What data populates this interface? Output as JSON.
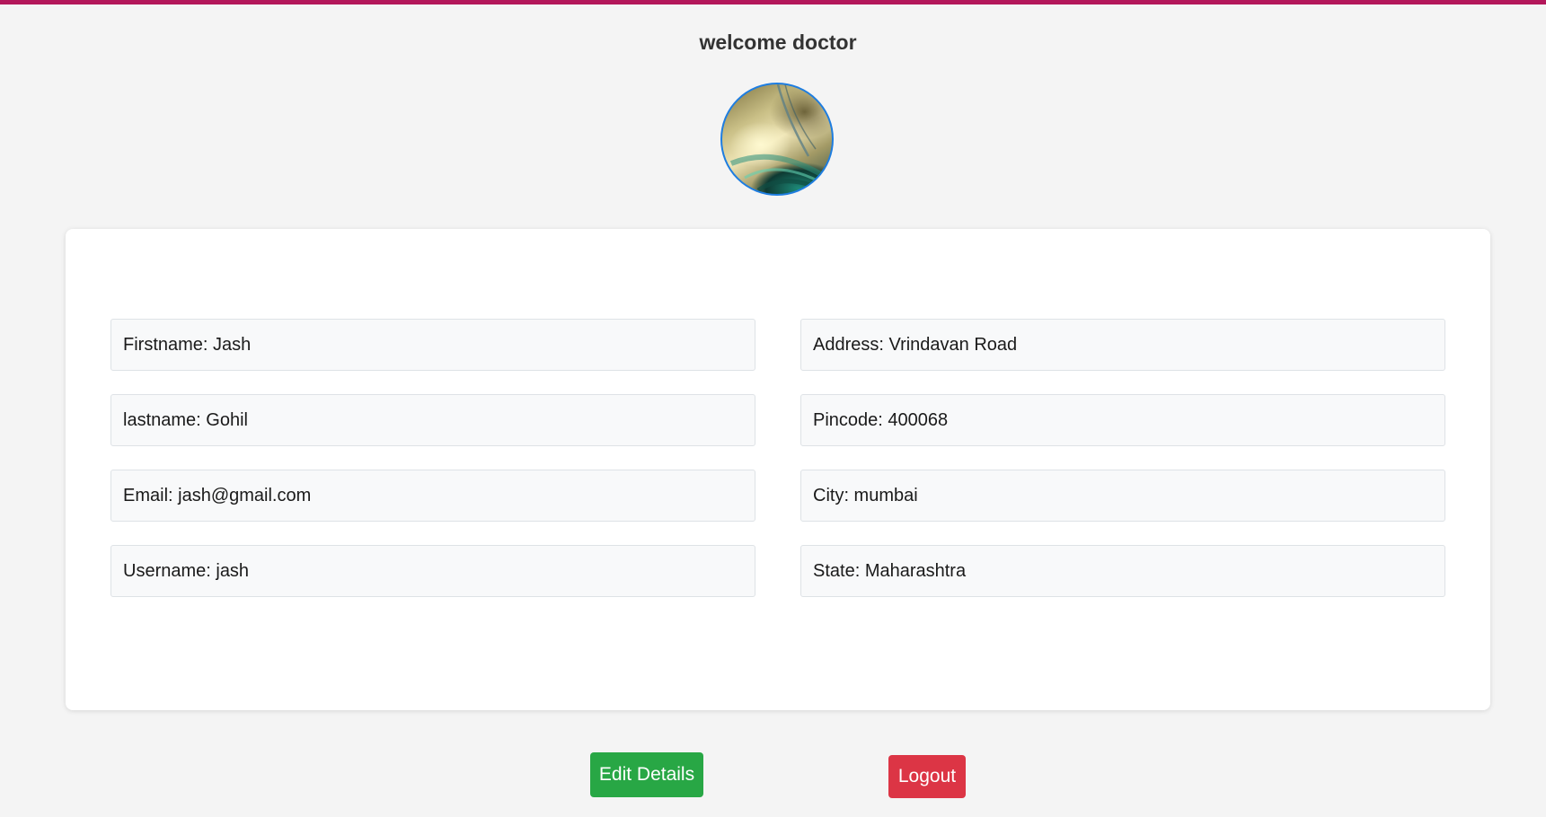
{
  "header": {
    "title": "welcome doctor"
  },
  "profile": {
    "avatar_icon": "profile-photo",
    "fields": {
      "firstname": "Firstname: Jash",
      "lastname": "lastname: Gohil",
      "email": "Email: jash@gmail.com",
      "username": "Username: jash",
      "address": "Address: Vrindavan Road",
      "pincode": "Pincode: 400068",
      "city": "City: mumbai",
      "state": "State: Maharashtra"
    }
  },
  "actions": {
    "edit_label": "Edit Details",
    "logout_label": "Logout"
  },
  "colors": {
    "top_bar": "#b3175a",
    "edit_button": "#28a745",
    "logout_button": "#dc3545",
    "avatar_border": "#1e7de0"
  }
}
